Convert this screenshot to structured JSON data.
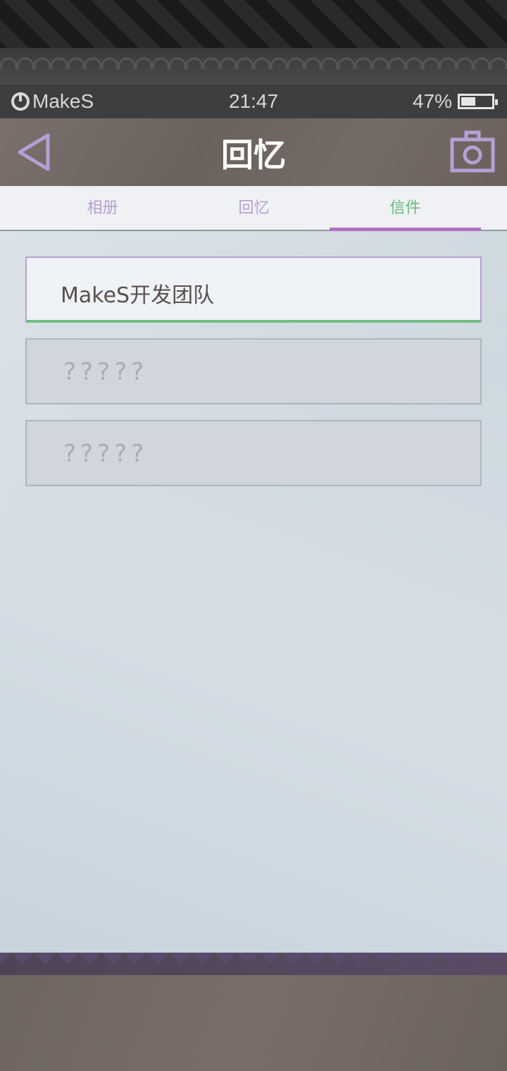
{
  "statusbar": {
    "brand": "MakeS",
    "time": "21:47",
    "battery": "47%",
    "battery_level": 0.47
  },
  "header": {
    "title": "回忆",
    "back_icon": "back-triangle-icon",
    "camera_icon": "camera-icon"
  },
  "tabs": [
    {
      "label": "相册",
      "active": false
    },
    {
      "label": "回忆",
      "active": false
    },
    {
      "label": "信件",
      "active": true
    }
  ],
  "letters": [
    {
      "label": "MakeS开发团队",
      "locked": false
    },
    {
      "label": "?????",
      "locked": true
    },
    {
      "label": "?????",
      "locked": true
    }
  ],
  "colors": {
    "accent_purple": "#b071c8",
    "active_green": "#6ab97c",
    "tab_inactive": "#b7a0cf"
  }
}
